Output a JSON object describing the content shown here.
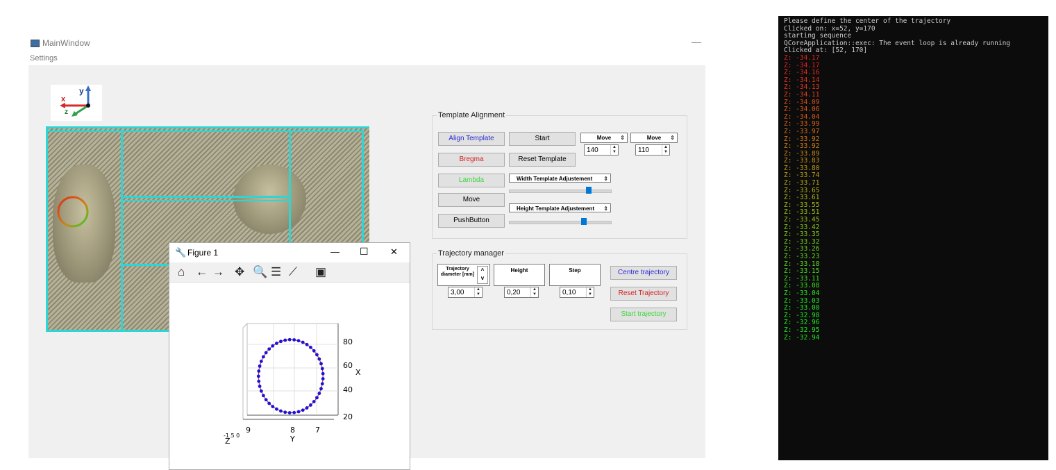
{
  "main_window": {
    "title": "MainWindow",
    "minimize_glyph": "—",
    "menu": [
      "Settings"
    ]
  },
  "axes_icon": {
    "x_label": "x",
    "y_label": "y",
    "z_label": "z"
  },
  "template_alignment": {
    "title": "Template Alignment",
    "align_template": "Align Template",
    "start": "Start",
    "bregma": "Bregma",
    "reset_template": "Reset Template",
    "lambda": "Lambda",
    "move": "Move",
    "pushbutton": "PushButton",
    "move_combo_1": {
      "label": "Move",
      "value": "140"
    },
    "move_combo_2": {
      "label": "Move",
      "value": "110"
    },
    "width_adjust": {
      "label": "Width Template Adjustement",
      "level": 0.7
    },
    "height_adjust": {
      "label": "Height Template Adjustement",
      "level": 0.7
    }
  },
  "trajectory_manager": {
    "title": "Trajectory manager",
    "diameter": {
      "label": "Trajectory diameter [mm]",
      "value": "3,00"
    },
    "height": {
      "label": "Height",
      "value": "0,20"
    },
    "step": {
      "label": "Step",
      "value": "0,10"
    },
    "centre_trajectory": "Centre trajectory",
    "reset_trajectory": "Reset Trajectory",
    "start_trajectory": "Start trajectory"
  },
  "figure": {
    "title": "Figure 1",
    "controls": {
      "minimize": "—",
      "maximize": "☐",
      "close": "✕"
    },
    "toolbar_icons": [
      "home-icon",
      "back-icon",
      "forward-icon",
      "pan-icon",
      "zoom-icon",
      "configure-icon",
      "edit-curve-icon",
      "save-icon"
    ],
    "x_ticks": [
      "80",
      "60",
      "40",
      "20"
    ],
    "x_axis_label": "X",
    "y_ticks": [
      "9",
      "8",
      "7"
    ],
    "y_axis_label": "Y",
    "z_axis_label": "Z",
    "z_ticks_overlap": "-1.5 0"
  },
  "chart_data": {
    "type": "scatter",
    "title": "",
    "xlabel": "Y",
    "ylabel": "X",
    "zlabel": "Z",
    "description_points": "circular trajectory of points",
    "x_ticks": [
      9,
      8,
      7
    ],
    "y_ticks": [
      20,
      40,
      60,
      80
    ],
    "center": [
      8.2,
      53
    ],
    "radius_y": 1.5,
    "radius_x": 31,
    "n_points": 45,
    "marker_color": "#1a14d6",
    "line_color": "#d8325a"
  },
  "console": {
    "lines": [
      {
        "text": "Please define the center of the trajectory",
        "color": "#cccccc"
      },
      {
        "text": "Clicked on: x=52, y=170",
        "color": "#cccccc"
      },
      {
        "text": "starting sequence",
        "color": "#cccccc"
      },
      {
        "text": "QCoreApplication::exec: The event loop is already running",
        "color": "#cccccc"
      },
      {
        "text": "Clicked at: [52, 170]",
        "color": "#cccccc"
      },
      {
        "text": "Z: -34.17",
        "color": "#e32222"
      },
      {
        "text": "Z: -34.17",
        "color": "#e32222"
      },
      {
        "text": "Z: -34.16",
        "color": "#e42a20"
      },
      {
        "text": "Z: -34.14",
        "color": "#e2331f"
      },
      {
        "text": "Z: -34.13",
        "color": "#e03b1e"
      },
      {
        "text": "Z: -34.11",
        "color": "#de441d"
      },
      {
        "text": "Z: -34.09",
        "color": "#dc4c1c"
      },
      {
        "text": "Z: -34.06",
        "color": "#da551b"
      },
      {
        "text": "Z: -34.04",
        "color": "#d85d1a"
      },
      {
        "text": "Z: -33.99",
        "color": "#d56619"
      },
      {
        "text": "Z: -33.97",
        "color": "#d26e18"
      },
      {
        "text": "Z: -33.92",
        "color": "#cf7718"
      },
      {
        "text": "Z: -33.92",
        "color": "#cc7f17"
      },
      {
        "text": "Z: -33.89",
        "color": "#c98816"
      },
      {
        "text": "Z: -33.83",
        "color": "#c59016"
      },
      {
        "text": "Z: -33.80",
        "color": "#c19815"
      },
      {
        "text": "Z: -33.74",
        "color": "#bda015"
      },
      {
        "text": "Z: -33.71",
        "color": "#b8a814"
      },
      {
        "text": "Z: -33.65",
        "color": "#b3af14"
      },
      {
        "text": "Z: -33.61",
        "color": "#aeb514"
      },
      {
        "text": "Z: -33.55",
        "color": "#a5b914"
      },
      {
        "text": "Z: -33.51",
        "color": "#9cbd15"
      },
      {
        "text": "Z: -33.45",
        "color": "#93c116"
      },
      {
        "text": "Z: -33.42",
        "color": "#89c517"
      },
      {
        "text": "Z: -33.35",
        "color": "#80c918"
      },
      {
        "text": "Z: -33.32",
        "color": "#76cd19"
      },
      {
        "text": "Z: -33.26",
        "color": "#6cd11a"
      },
      {
        "text": "Z: -33.23",
        "color": "#62d41b"
      },
      {
        "text": "Z: -33.18",
        "color": "#58d81c"
      },
      {
        "text": "Z: -33.15",
        "color": "#4edb1d"
      },
      {
        "text": "Z: -33.11",
        "color": "#44de1e"
      },
      {
        "text": "Z: -33.08",
        "color": "#3ae11f"
      },
      {
        "text": "Z: -33.04",
        "color": "#30e420"
      },
      {
        "text": "Z: -33.03",
        "color": "#28e621"
      },
      {
        "text": "Z: -33.00",
        "color": "#22e822"
      },
      {
        "text": "Z: -32.98",
        "color": "#22e822"
      },
      {
        "text": "Z: -32.96",
        "color": "#22e822"
      },
      {
        "text": "Z: -32.95",
        "color": "#22e822"
      },
      {
        "text": "Z: -32.94",
        "color": "#22e822"
      }
    ]
  }
}
